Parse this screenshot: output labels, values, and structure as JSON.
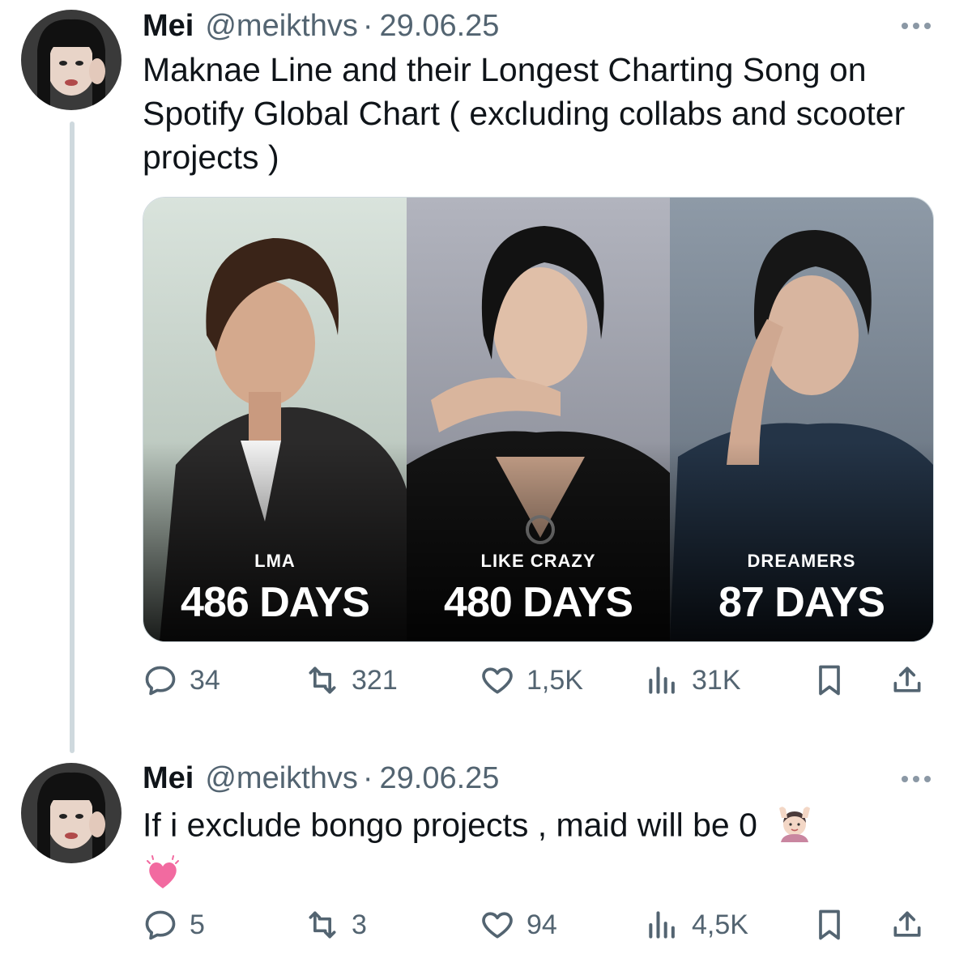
{
  "tweets": [
    {
      "author": {
        "name": "Mei",
        "handle": "@meikthvs",
        "date": "29.06.25"
      },
      "text": "Maknae Line and their Longest Charting Song on Spotify Global Chart ( excluding collabs and scooter projects )",
      "media": {
        "panels": [
          {
            "song": "LMA",
            "days": "486 DAYS"
          },
          {
            "song": "LIKE CRAZY",
            "days": "480 DAYS"
          },
          {
            "song": "DREAMERS",
            "days": "87 DAYS"
          }
        ]
      },
      "stats": {
        "replies": "34",
        "reposts": "321",
        "likes": "1,5K",
        "views": "31K"
      }
    },
    {
      "author": {
        "name": "Mei",
        "handle": "@meikthvs",
        "date": "29.06.25"
      },
      "text": "If i exclude bongo projects , maid will be 0",
      "emojis": [
        "person-raising-hands-emoji",
        "growing-heart-emoji"
      ],
      "stats": {
        "replies": "5",
        "reposts": "3",
        "likes": "94",
        "views": "4,5K"
      }
    }
  ],
  "colors": {
    "text": "#0f1419",
    "secondary": "#536471",
    "thread_line": "#cfd9de"
  }
}
